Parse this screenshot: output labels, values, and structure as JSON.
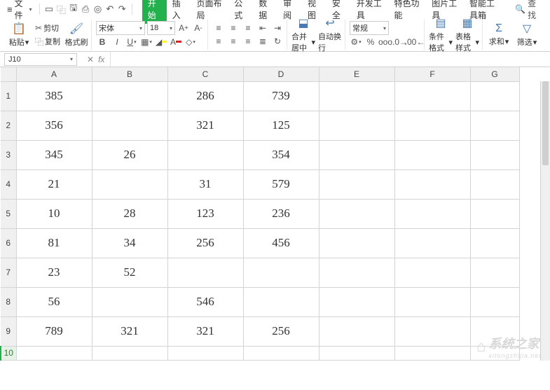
{
  "menubar": {
    "file": "文件",
    "tabs": [
      "开始",
      "插入",
      "页面布局",
      "公式",
      "数据",
      "审阅",
      "视图",
      "安全",
      "开发工具",
      "特色功能",
      "图片工具",
      "智能工具箱"
    ],
    "active_tab_index": 0,
    "search": "查找"
  },
  "ribbon": {
    "paste": "粘贴",
    "cut": "剪切",
    "copy": "复制",
    "format_painter": "格式刷",
    "font_name": "宋体",
    "font_size": "18",
    "merge_center": "合并居中",
    "auto_wrap": "自动换行",
    "number_format": "常规",
    "cond_format": "条件格式",
    "table_style": "表格样式",
    "sum": "求和",
    "filter": "筛选"
  },
  "namebox": "J10",
  "chart_data": {
    "type": "table",
    "columns": [
      "A",
      "B",
      "C",
      "D",
      "E",
      "F",
      "G"
    ],
    "rows": [
      {
        "A": "385",
        "B": "",
        "C": "286",
        "D": "739",
        "E": "",
        "F": "",
        "G": ""
      },
      {
        "A": "356",
        "B": "",
        "C": "321",
        "D": "125",
        "E": "",
        "F": "",
        "G": ""
      },
      {
        "A": "345",
        "B": "26",
        "C": "",
        "D": "354",
        "E": "",
        "F": "",
        "G": ""
      },
      {
        "A": "21",
        "B": "",
        "C": "31",
        "D": "579",
        "E": "",
        "F": "",
        "G": ""
      },
      {
        "A": "10",
        "B": "28",
        "C": "123",
        "D": "236",
        "E": "",
        "F": "",
        "G": ""
      },
      {
        "A": "81",
        "B": "34",
        "C": "256",
        "D": "456",
        "E": "",
        "F": "",
        "G": ""
      },
      {
        "A": "23",
        "B": "52",
        "C": "",
        "D": "",
        "E": "",
        "F": "",
        "G": ""
      },
      {
        "A": "56",
        "B": "",
        "C": "546",
        "D": "",
        "E": "",
        "F": "",
        "G": ""
      },
      {
        "A": "789",
        "B": "321",
        "C": "321",
        "D": "256",
        "E": "",
        "F": "",
        "G": ""
      },
      {
        "A": "",
        "B": "",
        "C": "",
        "D": "",
        "E": "",
        "F": "",
        "G": ""
      }
    ],
    "row_headers": [
      "1",
      "2",
      "3",
      "4",
      "5",
      "6",
      "7",
      "8",
      "9",
      "10"
    ],
    "active_cell": "J10",
    "active_row_index": 9
  },
  "watermark": {
    "title": "系统之家",
    "sub": "xitongzhijia.net"
  }
}
